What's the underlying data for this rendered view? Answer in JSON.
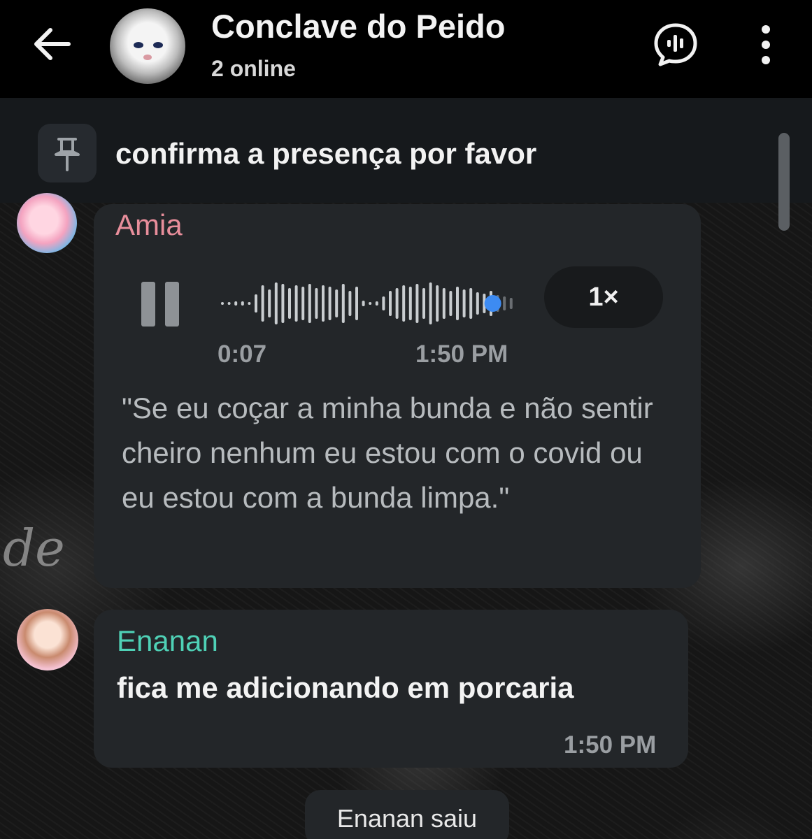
{
  "header": {
    "title": "Conclave do Peido",
    "subtitle": "2 online",
    "back_icon": "arrow-left-icon",
    "voice_chat_icon": "voice-chat-icon",
    "menu_icon": "more-vertical-icon"
  },
  "pinned": {
    "icon": "pin-icon",
    "text": "confirma a presença por favor"
  },
  "messages": [
    {
      "sender": "Amia",
      "sender_color": "#e88e9b",
      "type": "voice",
      "duration": "0:07",
      "time": "1:50 PM",
      "speed": "1×",
      "playback_progress": 0.92,
      "transcript": "\"Se eu coçar a minha bunda e não sentir cheiro nenhum eu estou com o covid ou eu estou com a bunda limpa.\""
    },
    {
      "sender": "Enanan",
      "sender_color": "#4fd1b6",
      "type": "text",
      "text": "fica me adicionando em porcaria",
      "time": "1:50 PM"
    }
  ],
  "system_message": "Enanan saiu",
  "wallpaper_text": "de",
  "colors": {
    "accent_blue": "#3d8bf2",
    "bubble": "#232629",
    "header": "#000000"
  }
}
